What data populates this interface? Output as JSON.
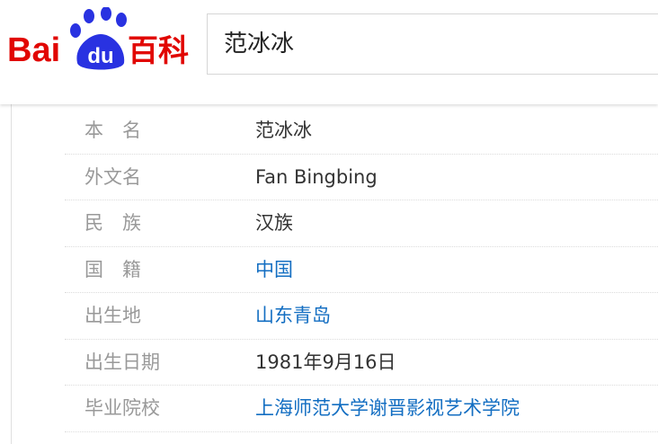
{
  "logo": {
    "text_left": "Bai",
    "text_paw": "du",
    "text_right": "百科",
    "colors": {
      "red": "#e10602",
      "blue": "#2932e1"
    }
  },
  "search": {
    "value": "范冰冰"
  },
  "info": [
    {
      "label": "本　名",
      "value": "范冰冰",
      "link": false
    },
    {
      "label": "外文名",
      "value": "Fan Bingbing",
      "link": false
    },
    {
      "label": "民　族",
      "value": "汉族",
      "link": false
    },
    {
      "label": "国　籍",
      "value": "中国",
      "link": true
    },
    {
      "label": "出生地",
      "value": "山东青岛",
      "link": true
    },
    {
      "label": "出生日期",
      "value": "1981年9月16日",
      "link": false
    },
    {
      "label": "毕业院校",
      "value": "上海师范大学谢晋影视艺术学院",
      "link": true
    }
  ],
  "colors": {
    "label": "#999999",
    "value": "#333333",
    "link": "#136ec2"
  }
}
